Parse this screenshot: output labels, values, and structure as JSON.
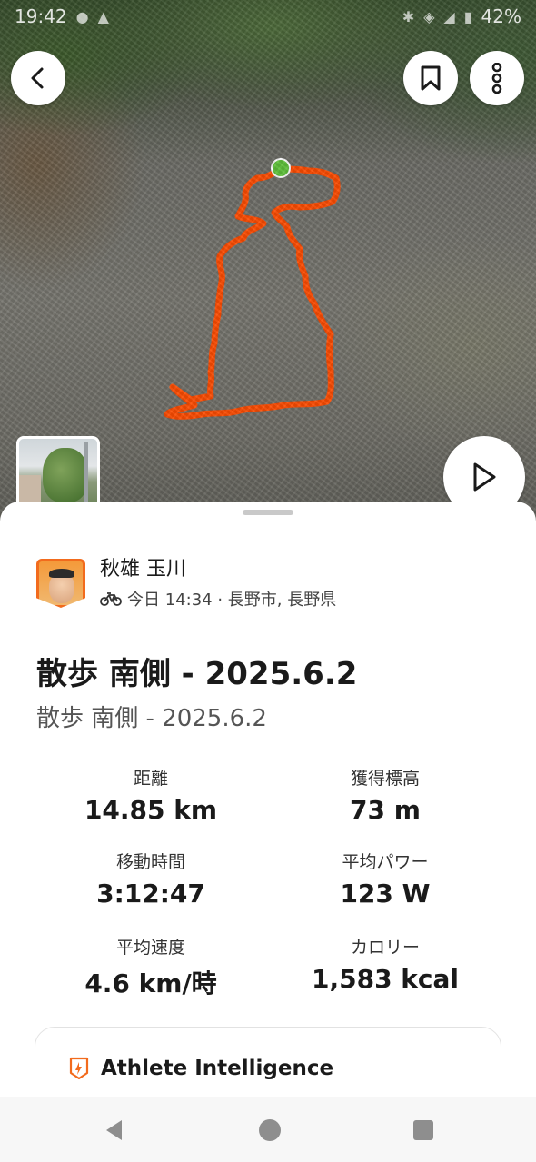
{
  "status_bar": {
    "time": "19:42",
    "battery": "42%"
  },
  "athlete": {
    "name": "秋雄 玉川",
    "activity_icon": "bicycle-icon",
    "meta": "今日 14:34 · 長野市, 長野県"
  },
  "activity": {
    "title": "散歩 南側 - 2025.6.2",
    "subtitle": "散歩 南側 - 2025.6.2"
  },
  "stats": [
    {
      "label": "距離",
      "value": "14.85 km"
    },
    {
      "label": "獲得標高",
      "value": "73 m"
    },
    {
      "label": "移動時間",
      "value": "3:12:47"
    },
    {
      "label": "平均パワー",
      "value": "123 W"
    },
    {
      "label": "平均速度",
      "value": "4.6 km/時"
    },
    {
      "label": "カロリー",
      "value": "1,583 kcal"
    }
  ],
  "athlete_intelligence": {
    "title": "Athlete Intelligence"
  },
  "colors": {
    "route": "#fc4c02",
    "start_marker": "#5ec13a",
    "accent": "#f26b1d"
  },
  "icons": {
    "back": "back-arrow-icon",
    "bookmark": "bookmark-icon",
    "more": "more-vertical-icon",
    "play": "play-icon",
    "ai": "athlete-intelligence-icon"
  }
}
